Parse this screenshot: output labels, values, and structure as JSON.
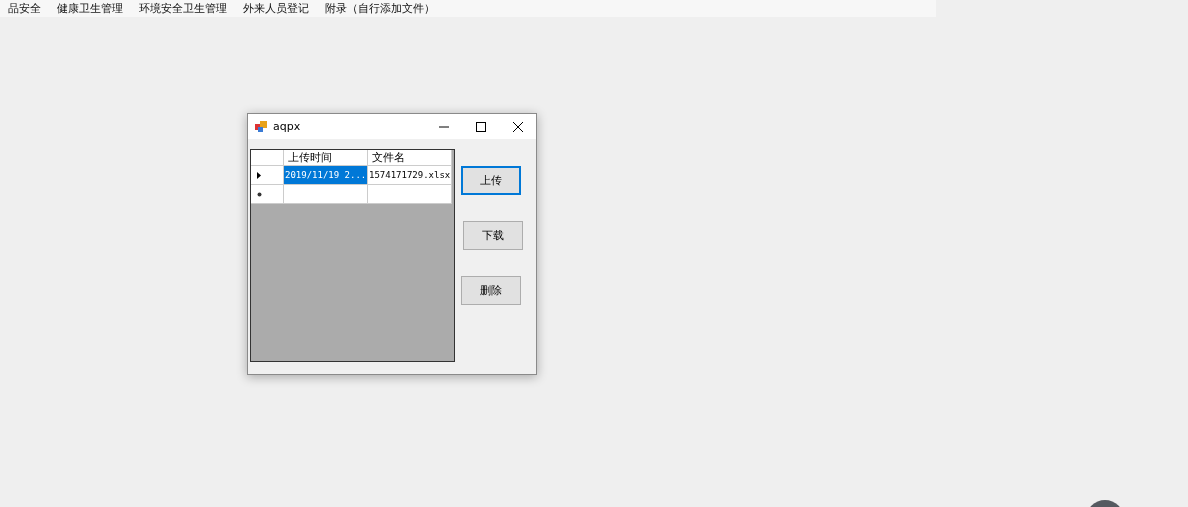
{
  "menu": [
    "品安全",
    "健康卫生管理",
    "环境安全卫生管理",
    "外来人员登记",
    "附录（自行添加文件）"
  ],
  "window": {
    "title": "aqpx"
  },
  "grid": {
    "columns": [
      "上传时间",
      "文件名"
    ],
    "rows": [
      {
        "kind": "current",
        "cells": [
          {
            "text": "2019/11/19 2...",
            "selected": true
          },
          {
            "text": "1574171729.xlsx",
            "selected": false
          }
        ]
      },
      {
        "kind": "new",
        "cells": []
      }
    ]
  },
  "buttons": [
    {
      "label": "上传",
      "focused": true
    },
    {
      "label": "下载",
      "focused": false
    },
    {
      "label": "删除",
      "focused": false
    }
  ]
}
